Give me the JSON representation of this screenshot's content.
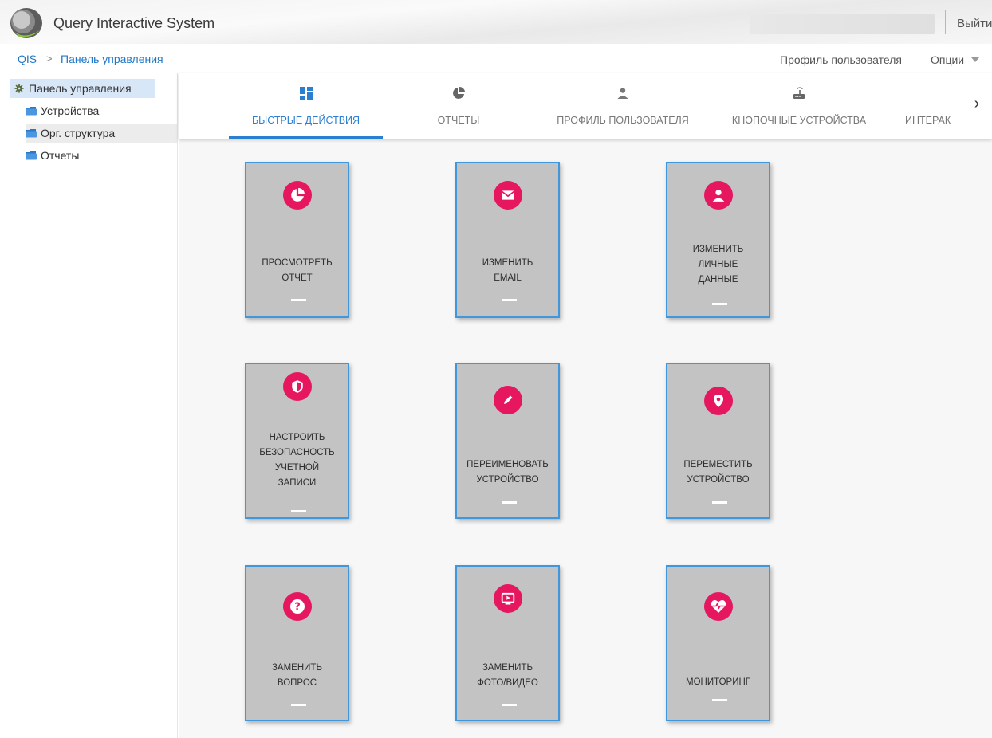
{
  "header": {
    "app_title": "Query Interactive System",
    "logout_label": "Выйти"
  },
  "breadcrumb": {
    "root": "QIS",
    "separator": ">",
    "current": "Панель управления"
  },
  "top_links": {
    "profile": "Профиль пользователя",
    "options": "Опции"
  },
  "sidebar": {
    "root_label": "Панель управления",
    "items": [
      {
        "label": "Устройства"
      },
      {
        "label": "Орг. структура"
      },
      {
        "label": "Отчеты"
      }
    ]
  },
  "tabs": [
    {
      "label": "БЫСТРЫЕ ДЕЙСТВИЯ",
      "icon": "dashboard-icon",
      "active": true
    },
    {
      "label": "ОТЧЕТЫ",
      "icon": "pie-chart-icon"
    },
    {
      "label": "ПРОФИЛЬ ПОЛЬЗОВАТЕЛЯ",
      "icon": "user-icon"
    },
    {
      "label": "КНОПОЧНЫЕ УСТРОЙСТВА",
      "icon": "router-icon"
    },
    {
      "label": "ИНТЕРАК",
      "icon": ""
    }
  ],
  "tiles": [
    {
      "lines": [
        "ПРОСМОТРЕТЬ",
        "ОТЧЕТ"
      ],
      "icon": "pie-chart-icon"
    },
    {
      "lines": [
        "ИЗМЕНИТЬ",
        "EMAIL"
      ],
      "icon": "envelope-icon"
    },
    {
      "lines": [
        "ИЗМЕНИТЬ",
        "ЛИЧНЫЕ",
        "ДАННЫЕ"
      ],
      "icon": "user-icon"
    },
    {
      "lines": [
        "НАСТРОИТЬ",
        "БЕЗОПАСНОСТЬ",
        "УЧЕТНОЙ",
        "ЗАПИСИ"
      ],
      "icon": "shield-icon"
    },
    {
      "lines": [
        "ПЕРЕИМЕНОВАТЬ",
        "УСТРОЙСТВО"
      ],
      "icon": "pencil-icon"
    },
    {
      "lines": [
        "ПЕРЕМЕСТИТЬ",
        "УСТРОЙСТВО"
      ],
      "icon": "location-pin-icon"
    },
    {
      "lines": [
        "ЗАМЕНИТЬ",
        "ВОПРОС"
      ],
      "icon": "question-icon"
    },
    {
      "lines": [
        "ЗАМЕНИТЬ",
        "ФОТО/ВИДЕО"
      ],
      "icon": "video-icon"
    },
    {
      "lines": [
        "МОНИТОРИНГ"
      ],
      "icon": "heart-pulse-icon"
    }
  ],
  "colors": {
    "accent": "#2a7fd1",
    "tile_icon_bg": "#e6165f",
    "tile_bg": "#c3c3c3",
    "tile_border": "#3f97dd"
  }
}
